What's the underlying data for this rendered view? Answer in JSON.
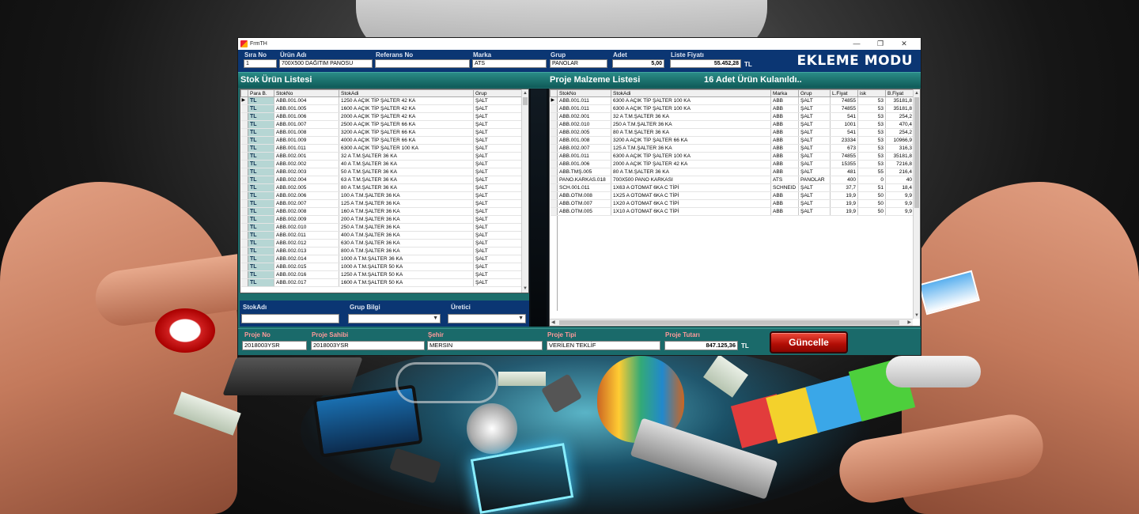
{
  "window": {
    "title": "FrmTH",
    "controls": {
      "minimize": "—",
      "maximize": "❐",
      "close": "✕"
    }
  },
  "top_form": {
    "sira_no": {
      "label": "Sıra No",
      "value": "1"
    },
    "urun_adi": {
      "label": "Ürün Adı",
      "value": "700X500 DAĞITIM PANOSU"
    },
    "referans_no": {
      "label": "Referans No",
      "value": ""
    },
    "marka": {
      "label": "Marka",
      "value": "ATS"
    },
    "grup": {
      "label": "Grup",
      "value": "PANOLAR"
    },
    "adet": {
      "label": "Adet",
      "value": "5,00"
    },
    "liste_fiyati": {
      "label": "Liste Fiyatı",
      "value": "55.452,28"
    },
    "currency": "TL",
    "mode_title": "EKLEME MODU"
  },
  "sections": {
    "stock_title": "Stok Ürün Listesi",
    "project_title": "Proje Malzeme Listesi",
    "used_count": "16 Adet Ürün Kulanıldı.."
  },
  "stock_grid": {
    "columns": [
      "Para B.",
      "StokNo",
      "StokAdi",
      "Grup"
    ],
    "rows": [
      [
        "TL",
        "ABB.001.004",
        "1250 A AÇIK TİP ŞALTER 42 KA",
        "ŞALT"
      ],
      [
        "TL",
        "ABB.001.005",
        "1600 A AÇIK TİP ŞALTER 42 KA",
        "ŞALT"
      ],
      [
        "TL",
        "ABB.001.006",
        "2000 A AÇIK TİP ŞALTER 42 KA",
        "ŞALT"
      ],
      [
        "TL",
        "ABB.001.007",
        "2500 A AÇIK TİP ŞALTER 66 KA",
        "ŞALT"
      ],
      [
        "TL",
        "ABB.001.008",
        "3200 A AÇIK TİP ŞALTER 66 KA",
        "ŞALT"
      ],
      [
        "TL",
        "ABB.001.009",
        "4000 A AÇIK TİP ŞALTER 66 KA",
        "ŞALT"
      ],
      [
        "TL",
        "ABB.001.011",
        "6300 A AÇIK TİP ŞALTER 100 KA",
        "ŞALT"
      ],
      [
        "TL",
        "ABB.002.001",
        "32 A T.M.ŞALTER 36 KA",
        "ŞALT"
      ],
      [
        "TL",
        "ABB.002.002",
        "40 A T.M.ŞALTER 36 KA",
        "ŞALT"
      ],
      [
        "TL",
        "ABB.002.003",
        "50 A T.M.ŞALTER 36 KA",
        "ŞALT"
      ],
      [
        "TL",
        "ABB.002.004",
        "63 A T.M.ŞALTER 36 KA",
        "ŞALT"
      ],
      [
        "TL",
        "ABB.002.005",
        "80 A T.M.ŞALTER 36 KA",
        "ŞALT"
      ],
      [
        "TL",
        "ABB.002.006",
        "100 A T.M.ŞALTER 36 KA",
        "ŞALT"
      ],
      [
        "TL",
        "ABB.002.007",
        "125 A T.M.ŞALTER 36 KA",
        "ŞALT"
      ],
      [
        "TL",
        "ABB.002.008",
        "160 A T.M.ŞALTER 36 KA",
        "ŞALT"
      ],
      [
        "TL",
        "ABB.002.009",
        "200 A T.M.ŞALTER 36 KA",
        "ŞALT"
      ],
      [
        "TL",
        "ABB.002.010",
        "250 A T.M.ŞALTER 36 KA",
        "ŞALT"
      ],
      [
        "TL",
        "ABB.002.011",
        "400 A T.M.ŞALTER 36 KA",
        "ŞALT"
      ],
      [
        "TL",
        "ABB.002.012",
        "630 A T.M.ŞALTER 36 KA",
        "ŞALT"
      ],
      [
        "TL",
        "ABB.002.013",
        "800 A T.M.ŞALTER 36 KA",
        "ŞALT"
      ],
      [
        "TL",
        "ABB.002.014",
        "1000 A T.M.ŞALTER 36 KA",
        "ŞALT"
      ],
      [
        "TL",
        "ABB.002.015",
        "1000 A T.M.ŞALTER 50 KA",
        "ŞALT"
      ],
      [
        "TL",
        "ABB.002.016",
        "1250 A T.M.ŞALTER 50 KA",
        "ŞALT"
      ],
      [
        "TL",
        "ABB.002.017",
        "1600 A T.M.ŞALTER 50 KA",
        "ŞALT"
      ]
    ]
  },
  "project_grid": {
    "columns": [
      "StokNo",
      "StokAdi",
      "Marka",
      "Grup",
      "L.Fiyat",
      "isk",
      "B.Fiyat"
    ],
    "rows": [
      [
        "ABB.001.011",
        "6300 A AÇIK TİP ŞALTER 100 KA",
        "ABB",
        "ŞALT",
        "74855",
        "53",
        "35181,8"
      ],
      [
        "ABB.001.011",
        "6300 A AÇIK TİP ŞALTER 100 KA",
        "ABB",
        "ŞALT",
        "74855",
        "53",
        "35181,8"
      ],
      [
        "ABB.002.001",
        "32 A T.M.ŞALTER 36 KA",
        "ABB",
        "ŞALT",
        "541",
        "53",
        "254,2"
      ],
      [
        "ABB.002.010",
        "250 A T.M.ŞALTER 36 KA",
        "ABB",
        "ŞALT",
        "1001",
        "53",
        "470,4"
      ],
      [
        "ABB.002.005",
        "80 A T.M.ŞALTER 36 KA",
        "ABB",
        "ŞALT",
        "541",
        "53",
        "254,2"
      ],
      [
        "ABB.001.008",
        "3200 A AÇIK TİP ŞALTER 66 KA",
        "ABB",
        "ŞALT",
        "23334",
        "53",
        "10966,9"
      ],
      [
        "ABB.002.007",
        "125 A T.M.ŞALTER 36 KA",
        "ABB",
        "ŞALT",
        "673",
        "53",
        "316,3"
      ],
      [
        "ABB.001.011",
        "6300 A AÇIK TİP ŞALTER 100 KA",
        "ABB",
        "ŞALT",
        "74855",
        "53",
        "35181,8"
      ],
      [
        "ABB.001.006",
        "2000 A AÇIK TİP ŞALTER 42 KA",
        "ABB",
        "ŞALT",
        "15355",
        "53",
        "7216,8"
      ],
      [
        "ABB.TMŞ.005",
        "80 A T.M.ŞALTER 36 KA",
        "ABB",
        "ŞALT",
        "481",
        "55",
        "216,4"
      ],
      [
        "PANO.KARKAS.018",
        "700X500 PANO KARKASI",
        "ATS",
        "PANOLAR",
        "400",
        "0",
        "40"
      ],
      [
        "SCH.001.011",
        "1X63 A OTOMAT 6KA C TİPİ",
        "SCHNEID",
        "ŞALT",
        "37,7",
        "51",
        "18,4"
      ],
      [
        "ABB.OTM.008",
        "1X25 A OTOMAT 6KA C TİPİ",
        "ABB",
        "ŞALT",
        "19,9",
        "50",
        "9,9"
      ],
      [
        "ABB.OTM.007",
        "1X20 A OTOMAT 6KA C TİPİ",
        "ABB",
        "ŞALT",
        "19,9",
        "50",
        "9,9"
      ],
      [
        "ABB.OTM.005",
        "1X10 A OTOMAT 6KA C TİPİ",
        "ABB",
        "ŞALT",
        "19,9",
        "50",
        "9,9"
      ]
    ]
  },
  "filters": {
    "stok_adi": {
      "label": "StokAdı",
      "value": ""
    },
    "grup_bilgi": {
      "label": "Grup Bilgi",
      "value": ""
    },
    "uretici": {
      "label": "Üretici",
      "value": ""
    }
  },
  "bottom_form": {
    "proje_no": {
      "label": "Proje No",
      "value": "2018003YSR"
    },
    "proje_sahibi": {
      "label": "Proje Sahibi",
      "value": "2018003YSR"
    },
    "sehir": {
      "label": "Şehir",
      "value": "MERSIN"
    },
    "proje_tipi": {
      "label": "Proje Tipi",
      "value": "VERİLEN TEKLİF"
    },
    "proje_tutari": {
      "label": "Proje Tutarı",
      "value": "847.125,36"
    },
    "currency": "TL",
    "update_button": "Güncelle"
  },
  "icons": {
    "row_pointer": "▶",
    "scroll_up": "▲",
    "scroll_down": "▼",
    "scroll_left": "◀",
    "scroll_right": "▶",
    "dropdown": "▼"
  }
}
